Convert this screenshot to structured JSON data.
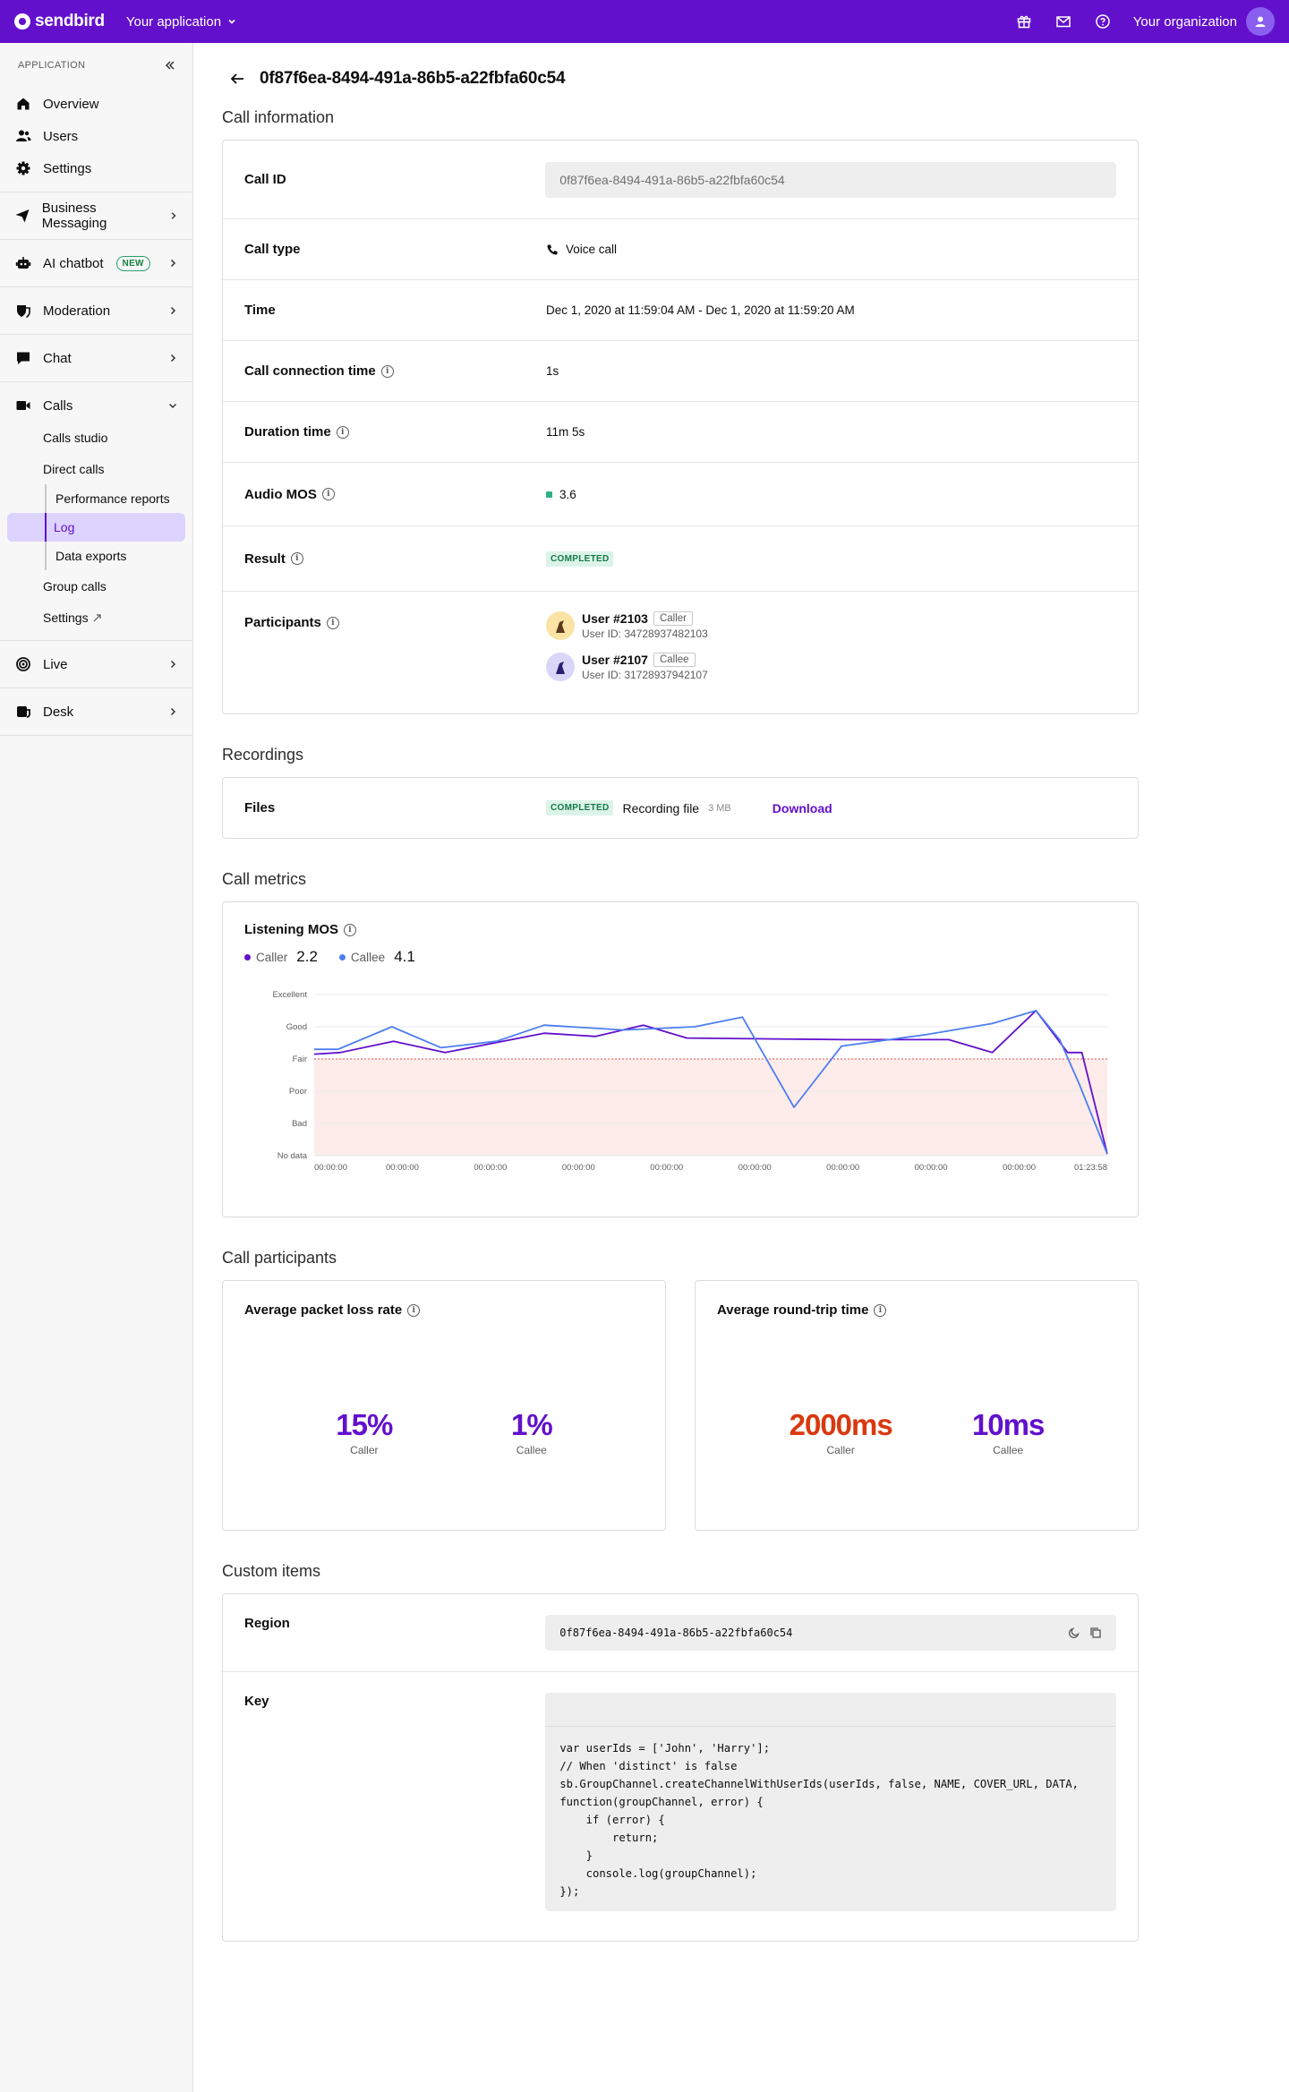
{
  "topbar": {
    "brand": "sendbird",
    "app_switcher": "Your application",
    "organization": "Your organization",
    "icons": [
      "gift-icon",
      "mail-icon",
      "help-icon"
    ]
  },
  "sidebar": {
    "section": "APPLICATION",
    "items": {
      "overview": "Overview",
      "users": "Users",
      "settings": "Settings",
      "business_messaging": "Business Messaging",
      "ai_chatbot": "AI chatbot",
      "ai_badge": "NEW",
      "moderation": "Moderation",
      "chat": "Chat",
      "calls": "Calls",
      "calls_studio": "Calls studio",
      "direct_calls": "Direct calls",
      "performance_reports": "Performance reports",
      "log": "Log",
      "data_exports": "Data exports",
      "group_calls": "Group calls",
      "calls_settings": "Settings",
      "live": "Live",
      "desk": "Desk"
    }
  },
  "page": {
    "title": "0f87f6ea-8494-491a-86b5-a22fbfa60c54"
  },
  "call_information": {
    "heading": "Call information",
    "call_id_label": "Call ID",
    "call_id": "0f87f6ea-8494-491a-86b5-a22fbfa60c54",
    "call_type_label": "Call type",
    "call_type": "Voice call",
    "time_label": "Time",
    "time": "Dec 1, 2020 at 11:59:04 AM - Dec 1, 2020 at 11:59:20 AM",
    "connection_label": "Call connection time",
    "connection": "1s",
    "duration_label": "Duration time",
    "duration": "11m 5s",
    "mos_label": "Audio MOS",
    "mos": "3.6",
    "result_label": "Result",
    "result": "COMPLETED",
    "participants_label": "Participants",
    "participants": [
      {
        "name": "User #2103",
        "role": "Caller",
        "user_id": "User ID: 34728937482103"
      },
      {
        "name": "User #2107",
        "role": "Callee",
        "user_id": "User ID: 31728937942107"
      }
    ]
  },
  "recordings": {
    "heading": "Recordings",
    "files_label": "Files",
    "status": "COMPLETED",
    "file_name": "Recording file",
    "file_size": "3 MB",
    "download": "Download"
  },
  "call_metrics": {
    "heading": "Call metrics",
    "chart_title": "Listening MOS",
    "caller_label": "Caller",
    "caller_value": "2.2",
    "callee_label": "Callee",
    "callee_value": "4.1",
    "caller_color": "#6210cc",
    "callee_color": "#4e7ef0"
  },
  "chart_data": {
    "type": "line",
    "title": "Listening MOS",
    "y_categories": [
      "No data",
      "Bad",
      "Poor",
      "Fair",
      "Good",
      "Excellent"
    ],
    "ylim": [
      0,
      5
    ],
    "x_tick_labels": [
      "00:00:00",
      "00:00:00",
      "00:00:00",
      "00:00:00",
      "00:00:00",
      "00:00:00",
      "00:00:00",
      "00:00:00",
      "00:00:00",
      "01:23:58"
    ],
    "xlim": [
      0,
      1
    ],
    "threshold": {
      "label": "Fair",
      "value": 3
    },
    "series": [
      {
        "name": "Caller",
        "color": "#6210cc",
        "x": [
          0,
          0.033,
          0.1,
          0.165,
          0.29,
          0.355,
          0.415,
          0.47,
          0.67,
          0.8,
          0.855,
          0.91,
          0.95,
          0.968,
          1.0
        ],
        "y": [
          3.15,
          3.2,
          3.55,
          3.2,
          3.8,
          3.7,
          4.05,
          3.65,
          3.6,
          3.6,
          3.2,
          4.5,
          3.2,
          3.2,
          0.05
        ]
      },
      {
        "name": "Callee",
        "color": "#4e7ef0",
        "x": [
          0,
          0.03,
          0.098,
          0.16,
          0.23,
          0.29,
          0.39,
          0.48,
          0.54,
          0.605,
          0.665,
          0.77,
          0.855,
          0.91,
          0.94,
          0.965,
          1.0
        ],
        "y": [
          3.3,
          3.3,
          4.0,
          3.35,
          3.55,
          4.05,
          3.9,
          4.0,
          4.3,
          1.5,
          3.4,
          3.75,
          4.1,
          4.5,
          3.6,
          2.2,
          0.05
        ]
      }
    ]
  },
  "call_participants": {
    "heading": "Call participants",
    "packet_loss": {
      "title": "Average packet loss rate",
      "caller_value": "15%",
      "caller_label": "Caller",
      "callee_value": "1%",
      "callee_label": "Callee"
    },
    "round_trip": {
      "title": "Average round-trip time",
      "caller_value": "2000ms",
      "caller_label": "Caller",
      "callee_value": "10ms",
      "callee_label": "Callee"
    },
    "colors": {
      "normal": "#6210cc",
      "alert": "#d93910"
    }
  },
  "custom_items": {
    "heading": "Custom items",
    "region_label": "Region",
    "region_value": "0f87f6ea-8494-491a-86b5-a22fbfa60c54",
    "key_label": "Key",
    "key_code": "var userIds = ['John', 'Harry'];\n// When 'distinct' is false\nsb.GroupChannel.createChannelWithUserIds(userIds, false, NAME, COVER_URL, DATA,\nfunction(groupChannel, error) {\n    if (error) {\n        return;\n    }\n    console.log(groupChannel);\n});"
  }
}
